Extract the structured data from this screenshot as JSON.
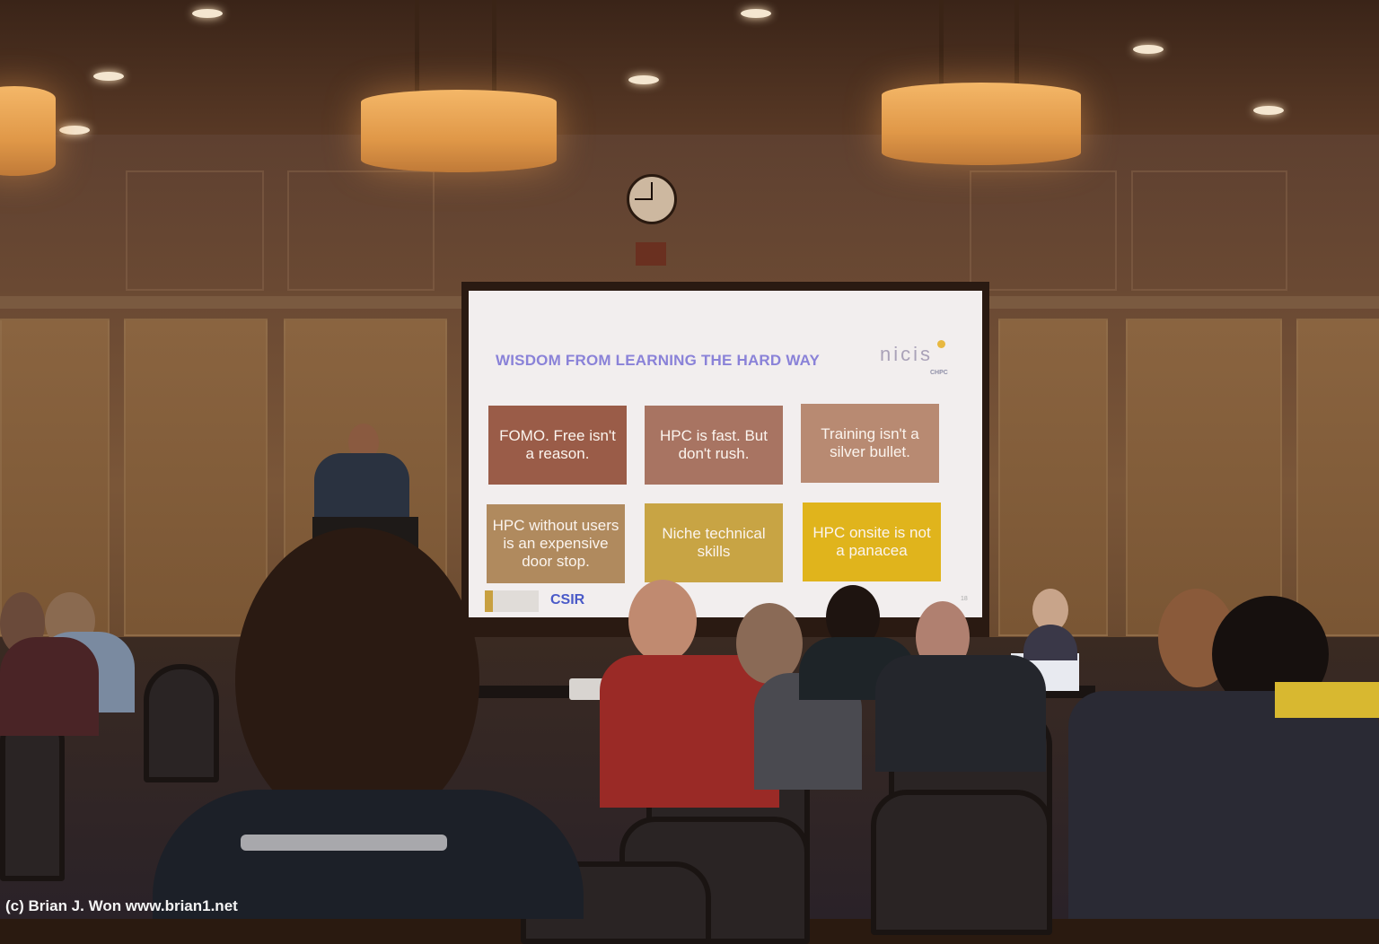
{
  "scene": {
    "description": "Conference session room with presenter at podium and projected slide",
    "watermark": "(c) Brian J. Won www.brian1.net"
  },
  "slide": {
    "title": "WISDOM FROM LEARNING THE HARD WAY",
    "logo": {
      "name": "nicis",
      "sub": "CHPC"
    },
    "cards": [
      {
        "text": "FOMO. Free isn't a reason.",
        "color": "#9a5c48"
      },
      {
        "text": "HPC is fast. But don't rush.",
        "color": "#a87462"
      },
      {
        "text": "Training isn't a silver bullet.",
        "color": "#b88a72"
      },
      {
        "text": "HPC without users is an expensive door stop.",
        "color": "#b08a5e"
      },
      {
        "text": "Niche technical skills",
        "color": "#c8a444"
      },
      {
        "text": "HPC onsite is not a panacea",
        "color": "#e0b41c"
      }
    ],
    "footer_logo": "CSIR",
    "page_number": "18",
    "title_color": "#8a82d8"
  },
  "colors": {
    "lamp": "#e8a050",
    "wall": "#7a5638",
    "screen": "#f2eeee"
  }
}
